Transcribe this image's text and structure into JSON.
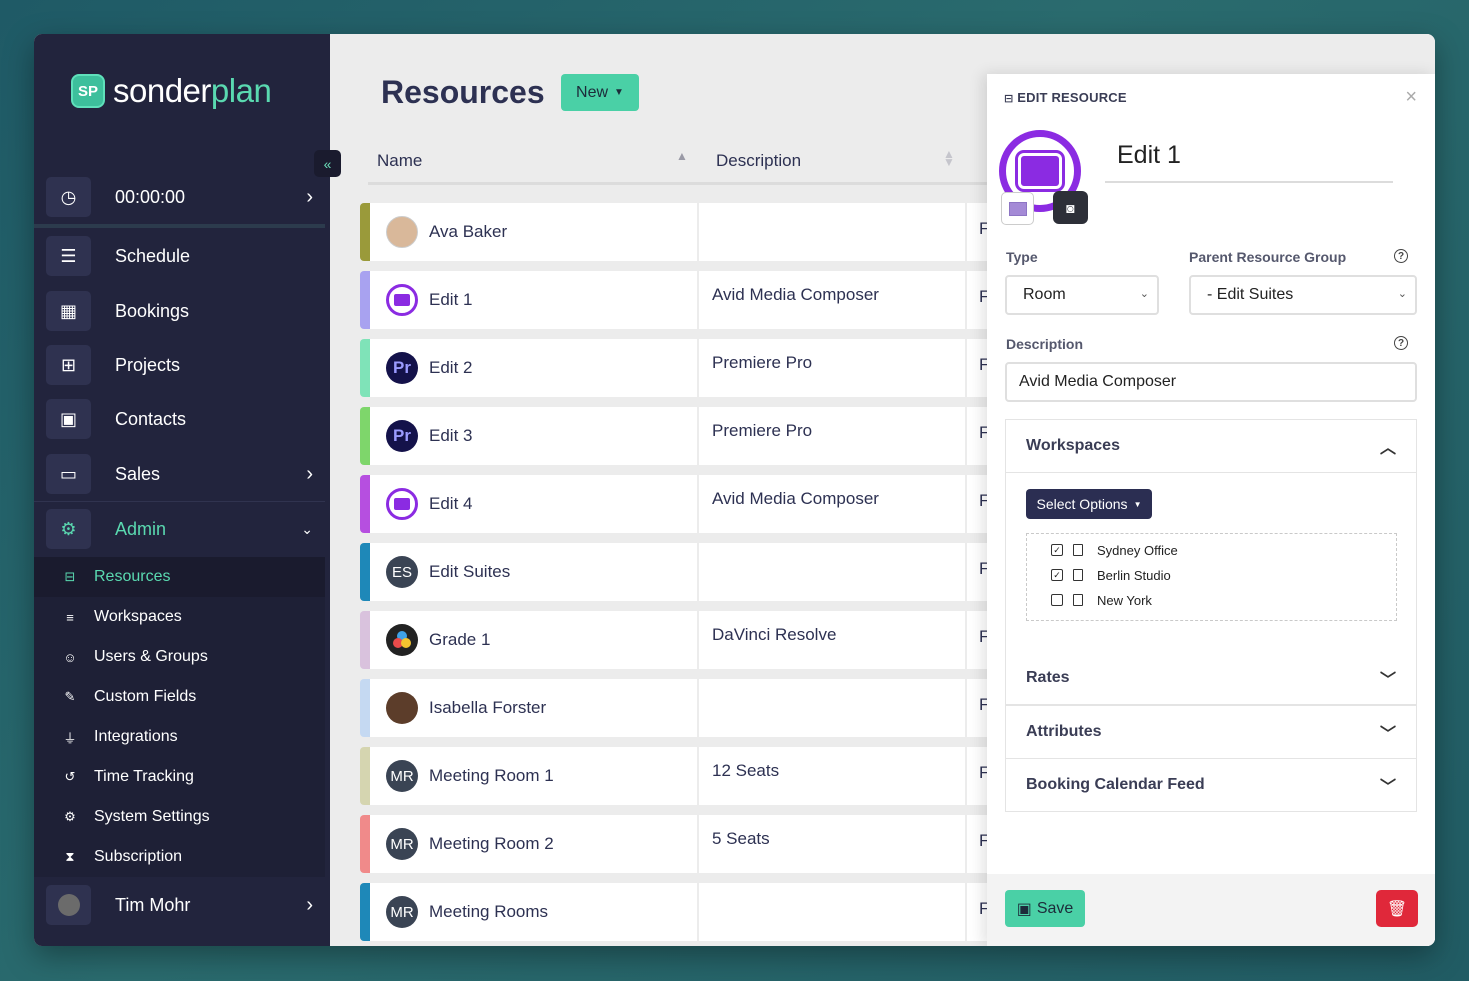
{
  "sidebar": {
    "brand_a": "sonder",
    "brand_b": "plan",
    "brand_logo": "SP",
    "collapse_icon": "«",
    "timer": "00:00:00",
    "items": [
      {
        "label": "Schedule"
      },
      {
        "label": "Bookings"
      },
      {
        "label": "Projects"
      },
      {
        "label": "Contacts"
      },
      {
        "label": "Sales"
      },
      {
        "label": "Admin"
      }
    ],
    "admin_sub": [
      {
        "label": "Resources",
        "icon": "⊟"
      },
      {
        "label": "Workspaces",
        "icon": "≡"
      },
      {
        "label": "Users & Groups",
        "icon": "☺"
      },
      {
        "label": "Custom Fields",
        "icon": "✎"
      },
      {
        "label": "Integrations",
        "icon": "⏚"
      },
      {
        "label": "Time Tracking",
        "icon": "↺"
      },
      {
        "label": "System Settings",
        "icon": "⚙"
      },
      {
        "label": "Subscription",
        "icon": "⧗"
      }
    ],
    "user": "Tim Mohr"
  },
  "main": {
    "title": "Resources",
    "new_label": "New",
    "col_name": "Name",
    "col_description": "Description",
    "rows": [
      {
        "name": "Ava Baker",
        "description": "",
        "third": "F",
        "icon": "photo",
        "initials": "",
        "stripe": "#9a9a3a"
      },
      {
        "name": "Edit 1",
        "description": "Avid Media Composer",
        "third": "F",
        "icon": "avid",
        "initials": "",
        "stripe": "#a8a2f0"
      },
      {
        "name": "Edit 2",
        "description": "Premiere Pro",
        "third": "F",
        "icon": "pr",
        "initials": "Pr",
        "stripe": "#7fe3b8"
      },
      {
        "name": "Edit 3",
        "description": "Premiere Pro",
        "third": "F",
        "icon": "pr",
        "initials": "Pr",
        "stripe": "#7ed66b"
      },
      {
        "name": "Edit 4",
        "description": "Avid Media Composer",
        "third": "F",
        "icon": "avid",
        "initials": "",
        "stripe": "#b64fe0"
      },
      {
        "name": "Edit Suites",
        "description": "",
        "third": "F",
        "icon": "init",
        "initials": "ES",
        "stripe": "#1e88b8"
      },
      {
        "name": "Grade 1",
        "description": "DaVinci Resolve",
        "third": "F",
        "icon": "davinci",
        "initials": "",
        "stripe": "#d9c2dd"
      },
      {
        "name": "Isabella Forster",
        "description": "",
        "third": "F",
        "icon": "photo2",
        "initials": "",
        "stripe": "#c5d9f2"
      },
      {
        "name": "Meeting Room 1",
        "description": "12 Seats",
        "third": "F",
        "icon": "init",
        "initials": "MR",
        "stripe": "#d5d5b0"
      },
      {
        "name": "Meeting Room 2",
        "description": "5 Seats",
        "third": "F",
        "icon": "init",
        "initials": "MR",
        "stripe": "#f08a8a"
      },
      {
        "name": "Meeting Rooms",
        "description": "",
        "third": "F",
        "icon": "init",
        "initials": "MR",
        "stripe": "#1e88b8"
      }
    ]
  },
  "panel": {
    "header": "EDIT RESOURCE",
    "close": "×",
    "name_value": "Edit 1",
    "type_label": "Type",
    "type_value": "Room",
    "parent_label": "Parent Resource Group",
    "parent_value": "- Edit Suites",
    "description_label": "Description",
    "description_value": "Avid Media Composer",
    "help_glyph": "?",
    "workspaces_label": "Workspaces",
    "select_options_label": "Select Options",
    "workspace_options": [
      {
        "label": "Sydney Office",
        "checked": true
      },
      {
        "label": "Berlin Studio",
        "checked": true
      },
      {
        "label": "New York",
        "checked": false
      }
    ],
    "rates_label": "Rates",
    "attributes_label": "Attributes",
    "calendar_label": "Booking Calendar Feed",
    "save_label": "Save"
  },
  "colors": {
    "accent": "#4ad0a6",
    "sidebar_bg": "#22243d",
    "danger": "#e0283a",
    "avid_purple": "#8b2be2"
  }
}
